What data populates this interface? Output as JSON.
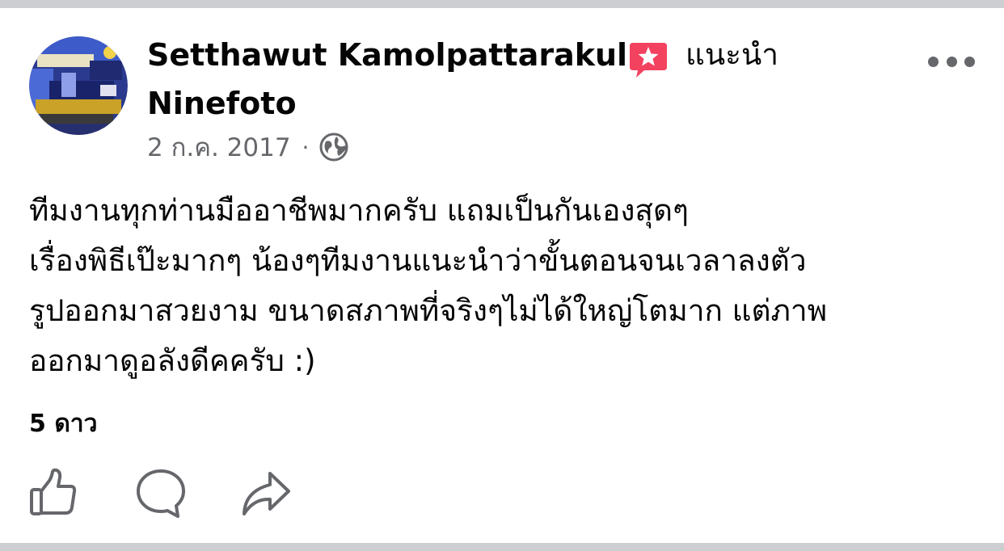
{
  "post": {
    "author_name": "Setthawut Kamolpattarakul",
    "recommends_label": "แนะนำ",
    "page_name": "Ninefoto",
    "date": "2 ก.ค. 2017",
    "meta_separator": "·",
    "audience_icon": "globe-icon",
    "badge_icon": "recommend-badge-icon",
    "more_icon": "more-options-icon",
    "body_lines": [
      "ทีมงานทุกท่านมืออาชีพมากครับ แถมเป็นกันเองสุดๆ",
      "เรื่องพิธีเป๊ะมากๆ น้องๆทีมงานแนะนำว่าขั้นตอนจนเวลาลงตัว",
      "รูปออกมาสวยงาม ขนาดสภาพที่จริงๆไม่ได้ใหญ่โตมาก แต่ภาพ",
      "ออกมาดูอลังดีคครับ :)"
    ],
    "rating_text": "5 ดาว",
    "actions": [
      "like-icon",
      "comment-icon",
      "share-icon"
    ]
  },
  "colors": {
    "text_primary": "#050505",
    "text_secondary": "#65676b",
    "badge_red": "#f3425f",
    "divider_gray": "#cdced2"
  }
}
